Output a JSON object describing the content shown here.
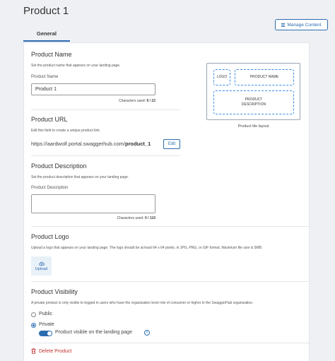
{
  "page": {
    "title": "Product 1"
  },
  "header": {
    "manage_content_label": "Manage Content"
  },
  "tabs": [
    {
      "label": "General"
    }
  ],
  "product_name": {
    "title": "Product Name",
    "description": "Set the product name that appears on your landing page.",
    "field_label": "Product Name",
    "value": "Product 1",
    "chars_prefix": "Characters used:",
    "chars_count": "9 / 22"
  },
  "tile_layout": {
    "logo": "LOGO",
    "name": "PRODUCT NAME",
    "description": "PRODUCT\nDESCRIPTION",
    "caption": "Product tile layout"
  },
  "product_url": {
    "title": "Product URL",
    "description": "Edit this field to create a unique product link.",
    "base": "https://aardwolf.portal.swaggerhub.com/",
    "slug": "product_1",
    "edit_label": "Edit"
  },
  "product_description": {
    "title": "Product Description",
    "description": "Set the product description that appears on your landing page.",
    "field_label": "Product Description",
    "value": "",
    "chars_prefix": "Characters used:",
    "chars_count": "0 / 110"
  },
  "product_logo": {
    "title": "Product Logo",
    "description": "Upload a logo that appears on your landing page. The logo should be at least 64 x 64 pixels, in JPG, PNG, or GIF format. Maximum file size is 5MB.",
    "upload_label": "Upload"
  },
  "product_visibility": {
    "title": "Product Visibility",
    "description": "A private product is only visible to logged in users who have the organization level role of consumer or higher in the SwaggerHub organization.",
    "options": [
      {
        "label": "Public",
        "selected": false
      },
      {
        "label": "Private",
        "selected": true
      }
    ],
    "toggle_label": "Product visible on the landing page",
    "toggle_on": true
  },
  "delete": {
    "label": "Delete Product"
  },
  "colors": {
    "accent": "#2b6cb0",
    "danger": "#c53030",
    "tile_border": "#3a8ee6"
  }
}
